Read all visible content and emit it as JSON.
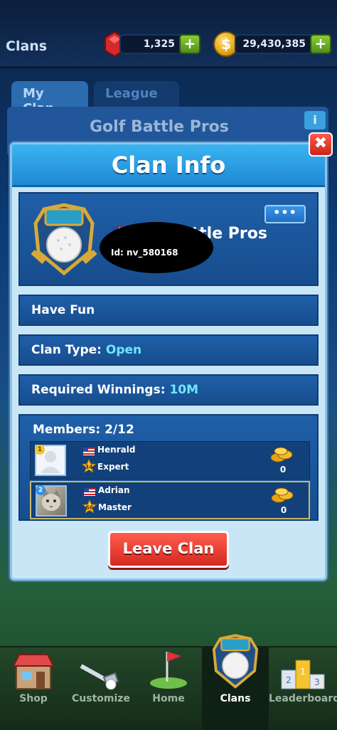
{
  "topbar": {
    "title": "Clans",
    "gems": "1,325",
    "coins": "29,430,385",
    "plus": "+"
  },
  "background": {
    "tabs": [
      "My Clan",
      "League"
    ],
    "clan_name": "Golf Battle Pros",
    "info_label": "i"
  },
  "modal": {
    "title": "Clan Info",
    "close_label": "✖",
    "more_label": "•••",
    "clan_name_visible": "Battle Pros",
    "clan_id": "Id: nv_580168",
    "description": "Have Fun",
    "clan_type_label": "Clan Type:",
    "clan_type_value": "Open",
    "required_label": "Required Winnings:",
    "required_value": "10M",
    "members_label": "Members: 2/12",
    "members": [
      {
        "name": "Henrald",
        "level": "34",
        "rank": "Expert",
        "coins": "0",
        "badge": "1",
        "avatar": "placeholder-avatar"
      },
      {
        "name": "Adrian",
        "level": "66",
        "rank": "Master",
        "coins": "0",
        "badge": "2",
        "avatar": "cat-avatar"
      }
    ],
    "leave_button": "Leave Clan"
  },
  "nav": {
    "items": [
      {
        "label": "Shop",
        "icon": "shop-icon",
        "active": false
      },
      {
        "label": "Customize",
        "icon": "golf-club-icon",
        "active": false
      },
      {
        "label": "Home",
        "icon": "flag-icon",
        "active": false
      },
      {
        "label": "Clans",
        "icon": "clan-crest-icon",
        "active": true
      },
      {
        "label": "Leaderboards",
        "icon": "podium-icon",
        "active": false
      }
    ]
  },
  "colors": {
    "accent_cyan": "#6ee6ff",
    "leave_red": "#d42a21",
    "plus_green": "#4f8f1a"
  }
}
